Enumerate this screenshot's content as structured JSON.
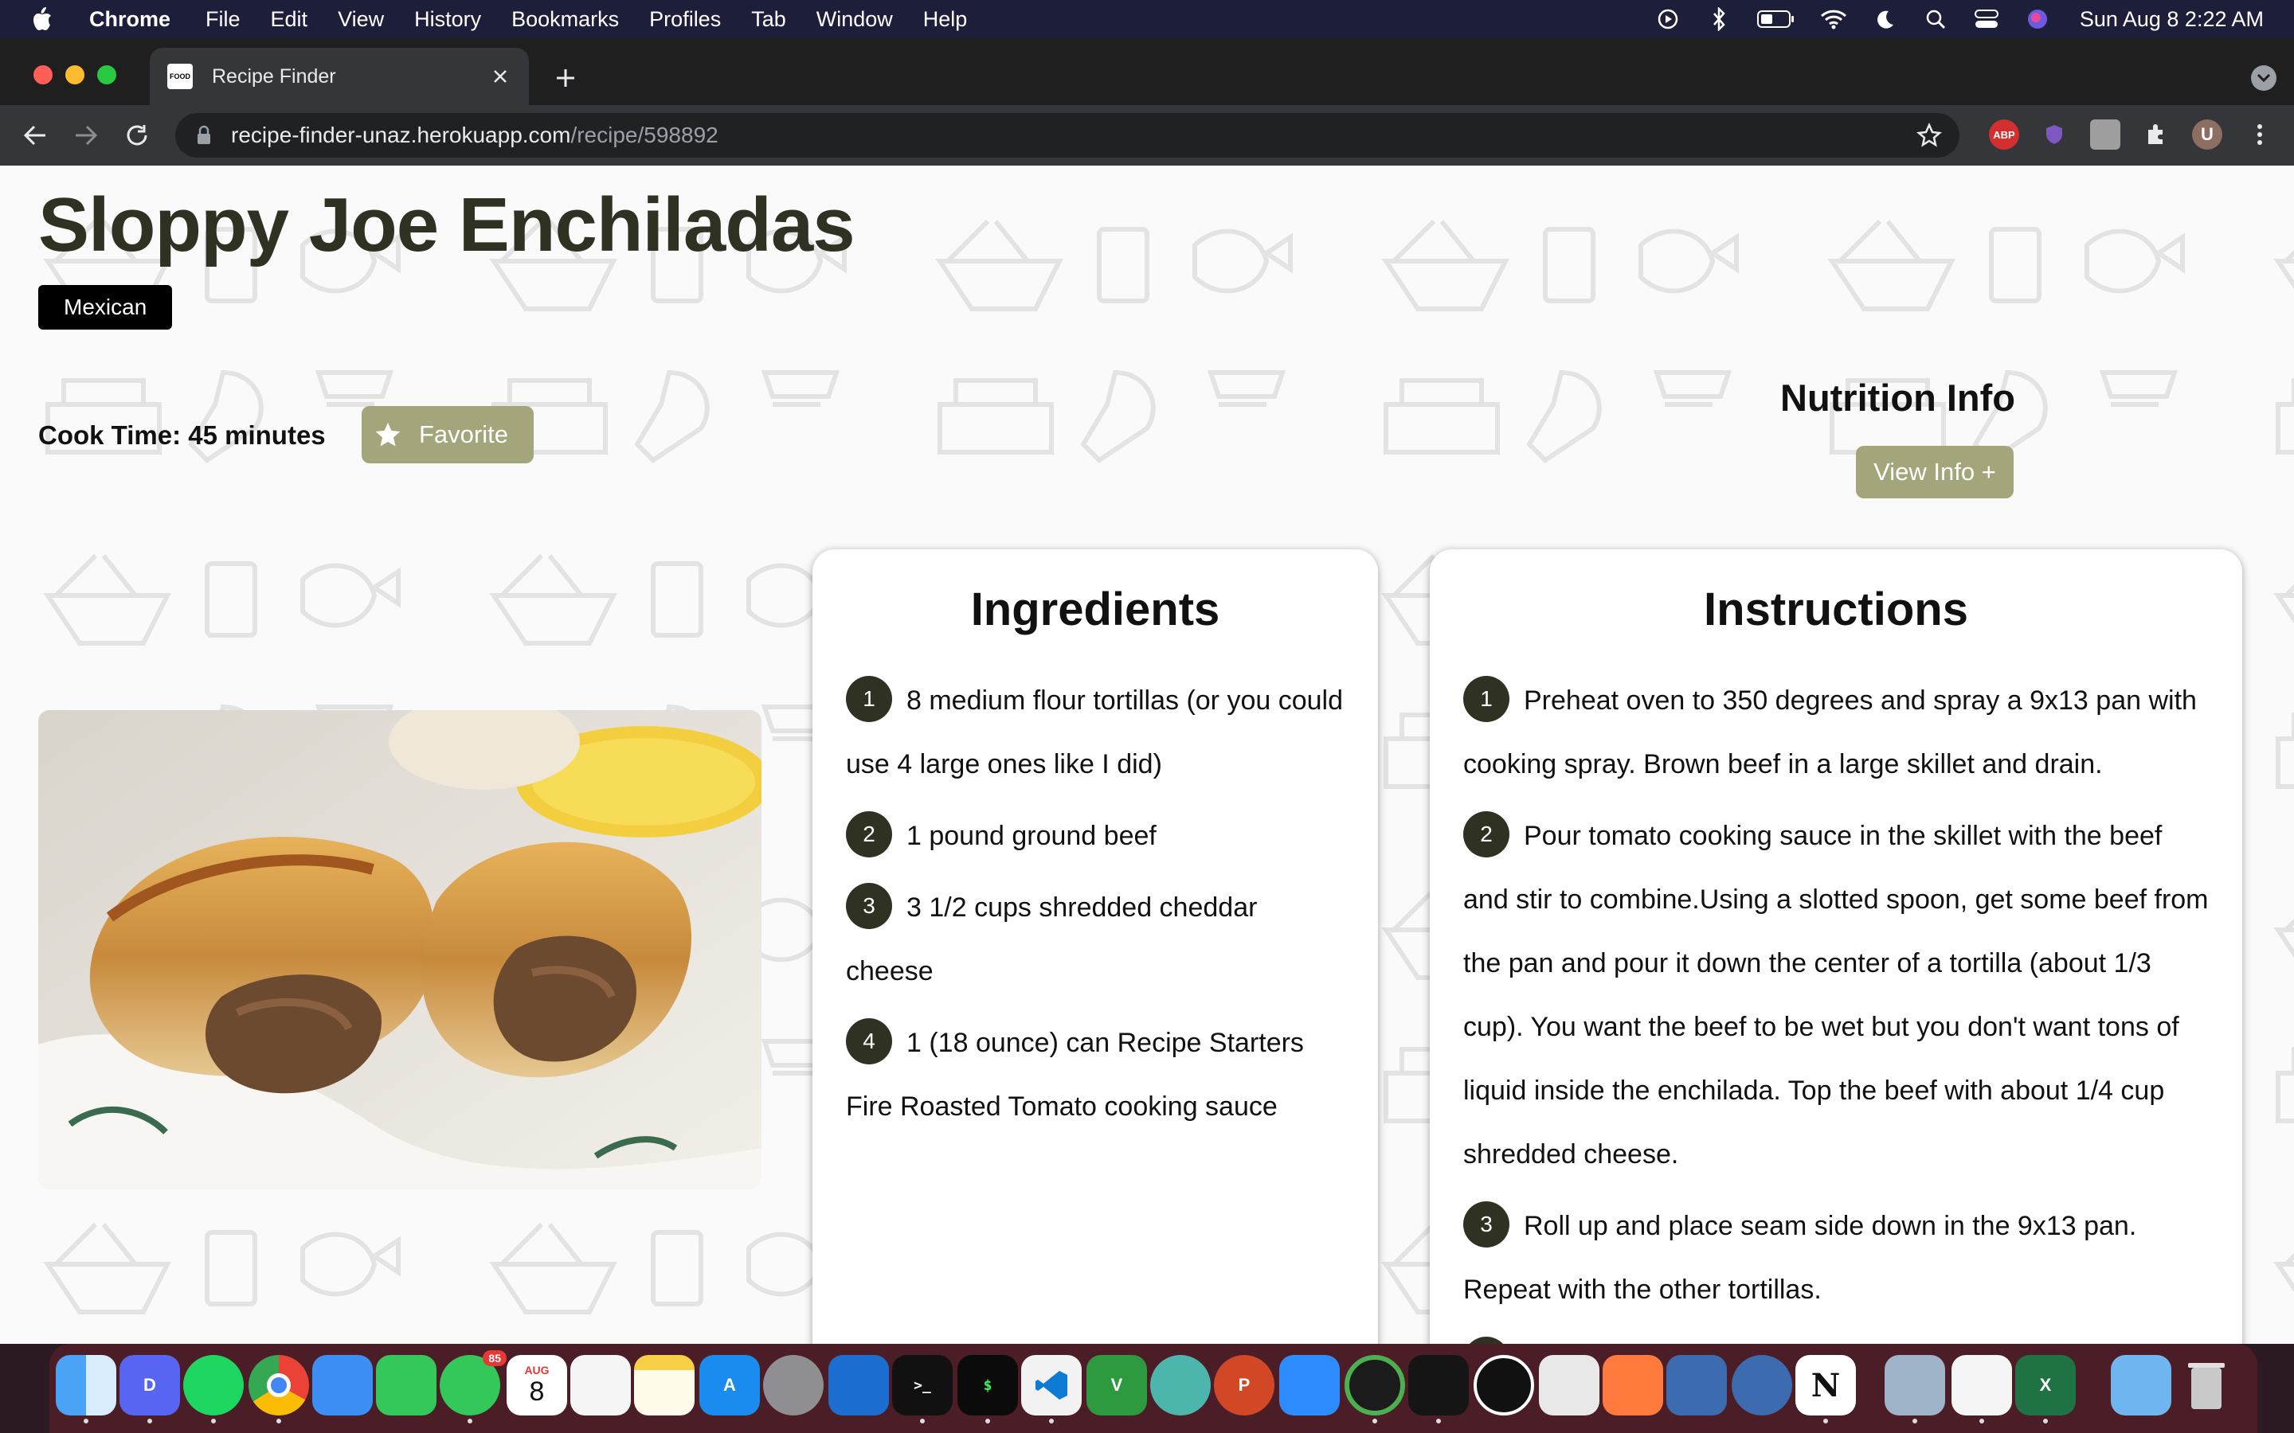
{
  "menubar": {
    "app_name": "Chrome",
    "items": [
      "File",
      "Edit",
      "View",
      "History",
      "Bookmarks",
      "Profiles",
      "Tab",
      "Window",
      "Help"
    ],
    "clock": "Sun Aug 8  2:22 AM"
  },
  "browser": {
    "tab_title": "Recipe Finder",
    "favicon_text": "FOOD",
    "url_host": "recipe-finder-unaz.herokuapp.com",
    "url_path": "/recipe/598892",
    "ext_abp": "ABP",
    "profile_initial": "U"
  },
  "recipe": {
    "title": "Sloppy Joe Enchiladas",
    "cuisine": "Mexican",
    "cook_time": "Cook Time: 45 minutes",
    "favorite_label": "Favorite",
    "nutrition_title": "Nutrition Info",
    "view_info_label": "View Info +",
    "ingredients_title": "Ingredients",
    "ingredients": [
      {
        "n": "1",
        "text": "8 medium flour tortillas (or you could use 4 large ones like I did)"
      },
      {
        "n": "2",
        "text": "1 pound ground beef"
      },
      {
        "n": "3",
        "text": "3 1/2 cups shredded cheddar cheese"
      },
      {
        "n": "4",
        "text": "1 (18 ounce) can Recipe Starters Fire Roasted Tomato cooking sauce"
      }
    ],
    "instructions_title": "Instructions",
    "instructions": [
      {
        "n": "1",
        "text": "Preheat oven to 350 degrees and spray a 9x13 pan with cooking spray. Brown beef in a large skillet and drain."
      },
      {
        "n": "2",
        "text": "Pour tomato cooking sauce in the skillet with the beef and stir to combine.Using a slotted spoon, get some beef from the pan and pour it down the center of a tortilla (about 1/3 cup). You want the beef to be wet but you don't want tons of liquid inside the enchilada. Top the beef with about 1/4 cup shredded cheese."
      },
      {
        "n": "3",
        "text": "Roll up and place seam side down in the 9x13 pan. Repeat with the other tortillas."
      }
    ]
  },
  "dock": {
    "messages_badge": "85",
    "calendar_month": "AUG",
    "calendar_day": "8"
  },
  "colors": {
    "accent_button": "#a5a57b",
    "title_color": "#2f3222",
    "menubar_bg": "#1d1f3a"
  }
}
